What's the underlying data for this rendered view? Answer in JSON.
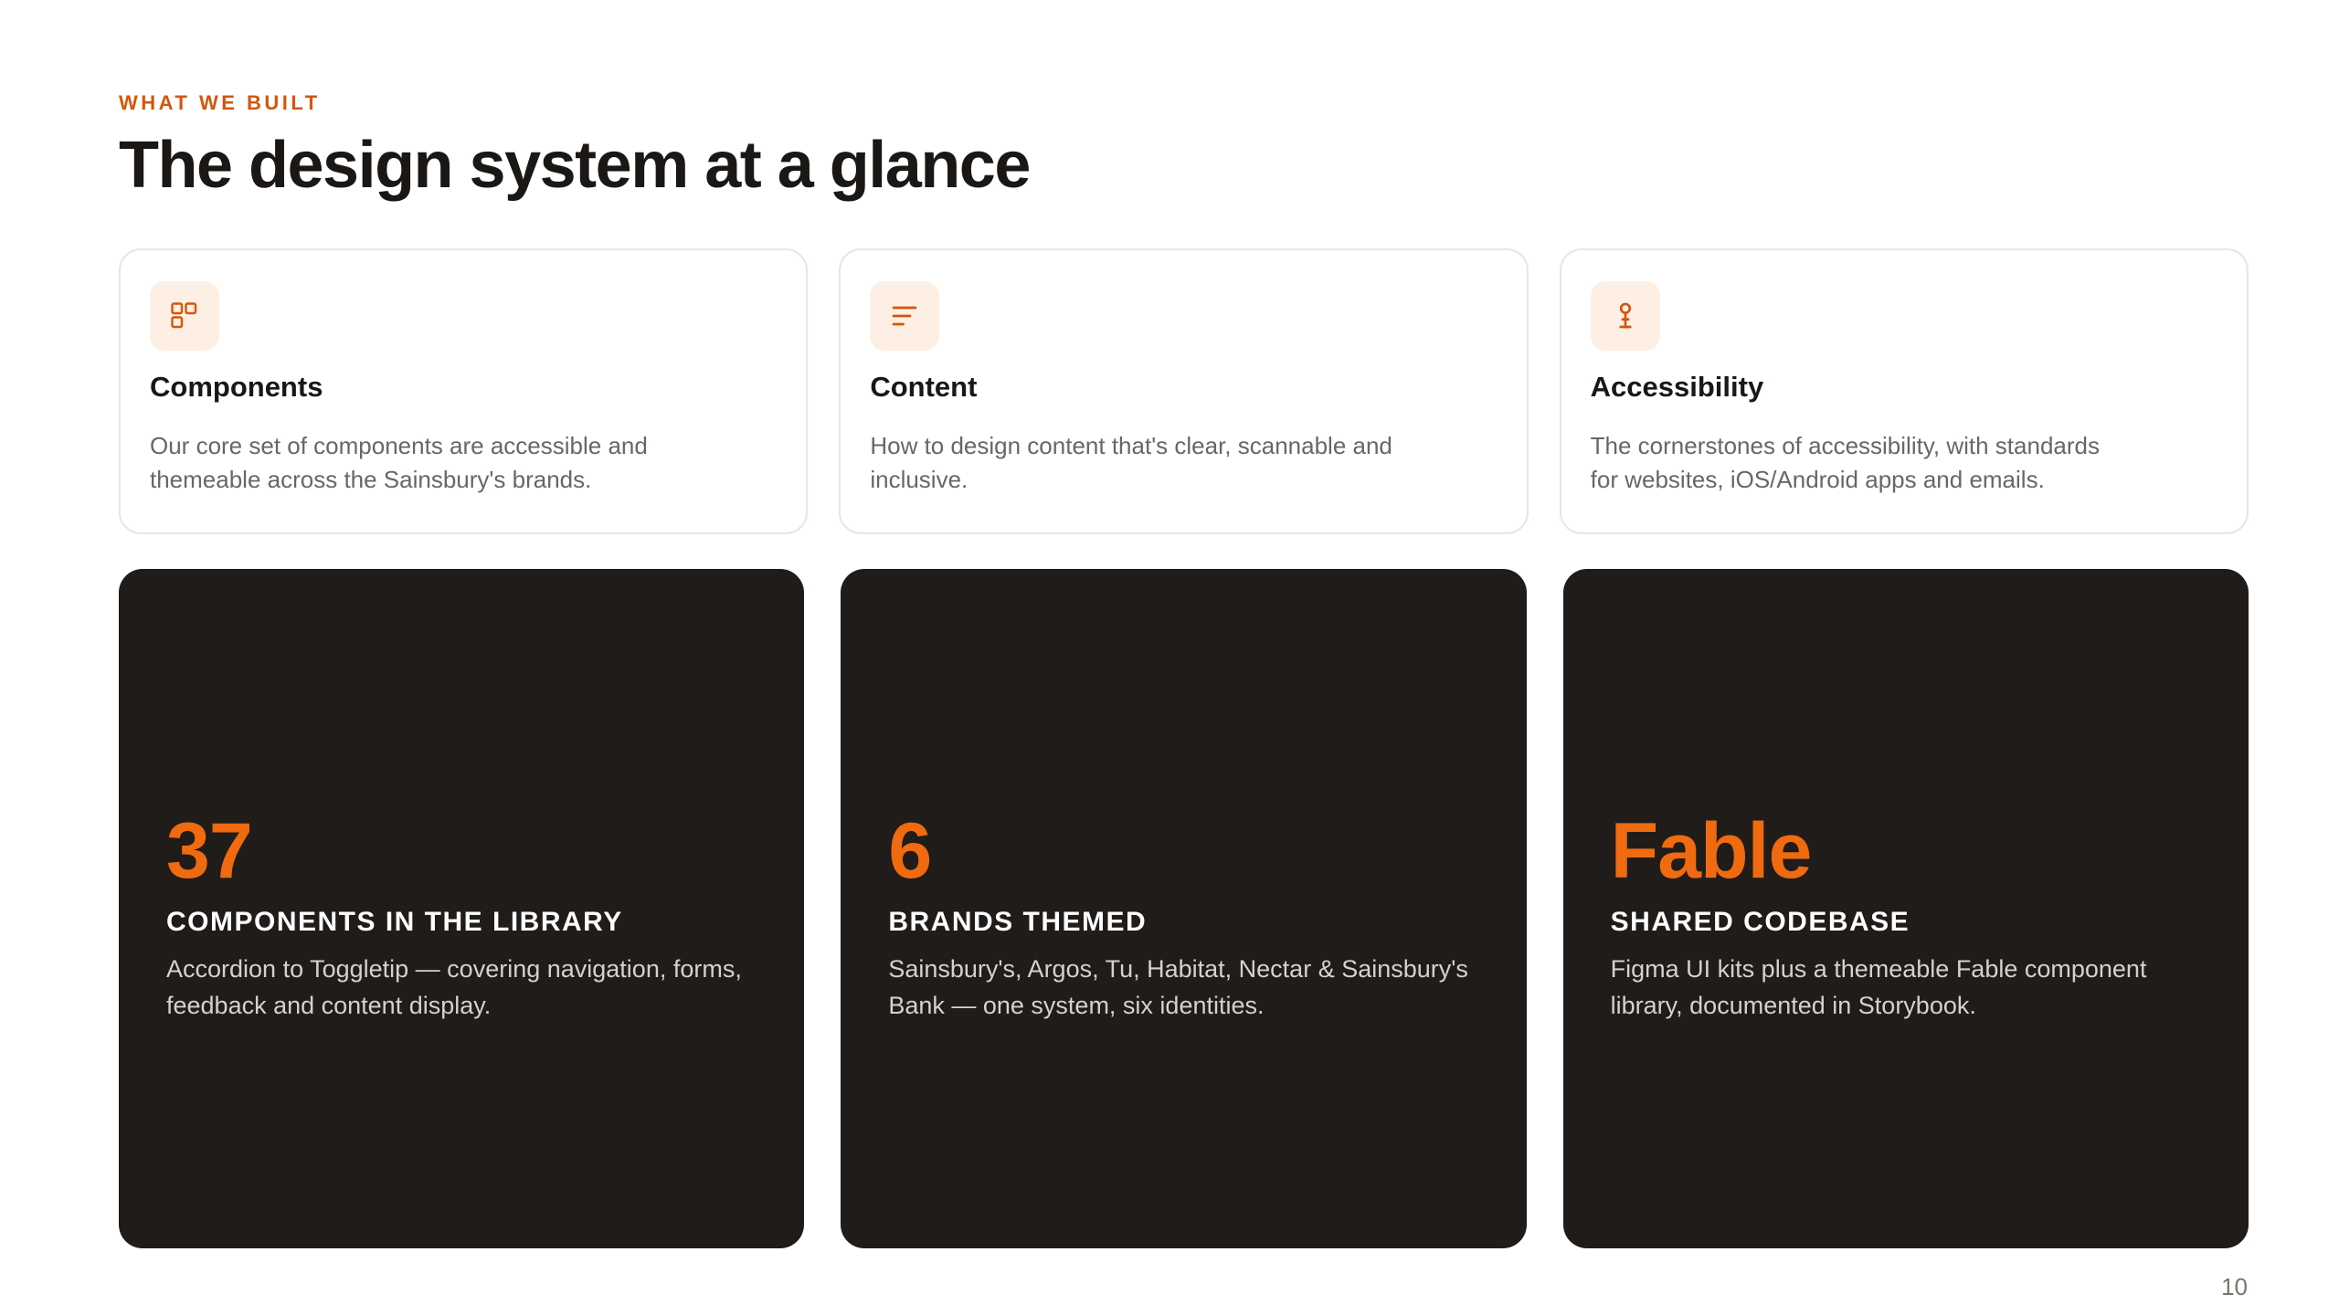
{
  "eyebrow": "WHAT WE BUILT",
  "title": "The design system at a glance",
  "accent_color": "#d4560a",
  "stat_color": "#f06a0f",
  "features": [
    {
      "icon": "components-icon",
      "title": "Components",
      "description": "Our core set of components are accessible and themeable across the Sainsbury's brands."
    },
    {
      "icon": "content-lines-icon",
      "title": "Content",
      "description": "How to design content that's clear, scannable and inclusive."
    },
    {
      "icon": "accessibility-pin-icon",
      "title": "Accessibility",
      "description": "The cornerstones of accessibility, with standards for websites, iOS/Android apps and emails."
    }
  ],
  "stats": [
    {
      "value": "37",
      "label": "COMPONENTS IN THE LIBRARY",
      "description": "Accordion to Toggletip — covering navigation, forms, feedback and content display."
    },
    {
      "value": "6",
      "label": "BRANDS THEMED",
      "description": "Sainsbury's, Argos, Tu, Habitat, Nectar & Sainsbury's Bank — one system, six identities."
    },
    {
      "value": "Fable",
      "label": "SHARED CODEBASE",
      "description": "Figma UI kits plus a themeable Fable component library, documented in Storybook."
    }
  ],
  "page_number": "10"
}
